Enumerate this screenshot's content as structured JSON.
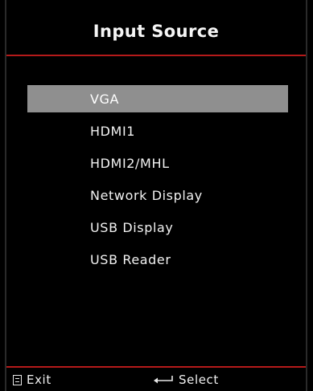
{
  "window": {
    "title": "Input Source"
  },
  "menu": {
    "items": [
      {
        "label": "VGA",
        "selected": true
      },
      {
        "label": "HDMI1",
        "selected": false
      },
      {
        "label": "HDMI2/MHL",
        "selected": false
      },
      {
        "label": "Network Display",
        "selected": false
      },
      {
        "label": "USB Display",
        "selected": false
      },
      {
        "label": "USB Reader",
        "selected": false
      }
    ]
  },
  "footer": {
    "exit": {
      "icon": "menu-icon",
      "label": "Exit"
    },
    "select": {
      "icon": "enter-icon",
      "label": "Select"
    }
  },
  "colors": {
    "background": "#000000",
    "accent_divider": "#b51a1a",
    "selected_highlight": "#8f8f8f",
    "text": "#f2f2f2"
  }
}
